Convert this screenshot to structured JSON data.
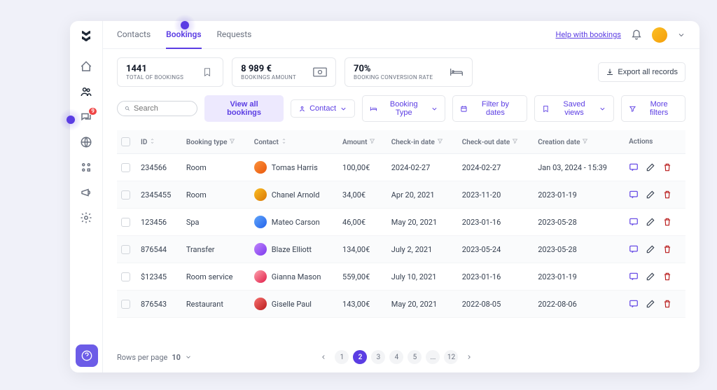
{
  "nav": {
    "tabs": [
      "Contacts",
      "Bookings",
      "Requests"
    ],
    "active": "Bookings",
    "help_link": "Help with bookings"
  },
  "stats": [
    {
      "value": "1441",
      "label": "TOTAL OF BOOKINGS",
      "icon": "bookmark"
    },
    {
      "value": "8 989 €",
      "label": "BOOKINGS AMOUNT",
      "icon": "money"
    },
    {
      "value": "70%",
      "label": "BOOKING CONVERSION RATE",
      "icon": "bed"
    }
  ],
  "export_label": "Export all records",
  "search": {
    "placeholder": "Search"
  },
  "filters": {
    "view_all": "View all bookings",
    "contact": "Contact",
    "booking_type": "Booking Type",
    "filter_dates": "Filter by dates",
    "saved_views": "Saved views",
    "more_filters": "More filters"
  },
  "columns": [
    "ID",
    "Booking type",
    "Contact",
    "Amount",
    "Check-in date",
    "Check-out date",
    "Creation date",
    "Actions"
  ],
  "rows": [
    {
      "id": "234566",
      "type": "Room",
      "contact": "Tomas Harris",
      "amount": "100,00€",
      "checkin": "2024-02-27",
      "checkout": "2024-02-27",
      "created": "Jan 03, 2024 - 15:39",
      "av": "av1"
    },
    {
      "id": "2345455",
      "type": "Room",
      "contact": "Chanel Arnold",
      "amount": "34,00€",
      "checkin": "Apr 20, 2021",
      "checkout": "2023-11-20",
      "created": "2023-01-19",
      "av": "av2"
    },
    {
      "id": "123456",
      "type": "Spa",
      "contact": "Mateo Carson",
      "amount": "46,00€",
      "checkin": "May 20, 2021",
      "checkout": "2023-01-16",
      "created": "2023-05-28",
      "av": "av3"
    },
    {
      "id": "876544",
      "type": "Transfer",
      "contact": "Blaze Elliott",
      "amount": "134,00€",
      "checkin": "July 2, 2021",
      "checkout": "2023-05-24",
      "created": "2023-05-28",
      "av": "av4"
    },
    {
      "id": "$12345",
      "type": "Room service",
      "contact": "Gianna Mason",
      "amount": "559,00€",
      "checkin": "July  10, 2021",
      "checkout": "2023-01-16",
      "created": "2023-01-19",
      "av": "av5"
    },
    {
      "id": "876543",
      "type": "Restaurant",
      "contact": "Giselle Paul",
      "amount": "143,00€",
      "checkin": "May 20, 2021",
      "checkout": "2022-08-05",
      "created": "2022-08-06",
      "av": "av6"
    }
  ],
  "pagination": {
    "rows_per_page_label": "Rows per page",
    "rows_per_page": "10",
    "pages": [
      "1",
      "2",
      "3",
      "4",
      "5",
      "...",
      "12"
    ],
    "active": "2"
  }
}
